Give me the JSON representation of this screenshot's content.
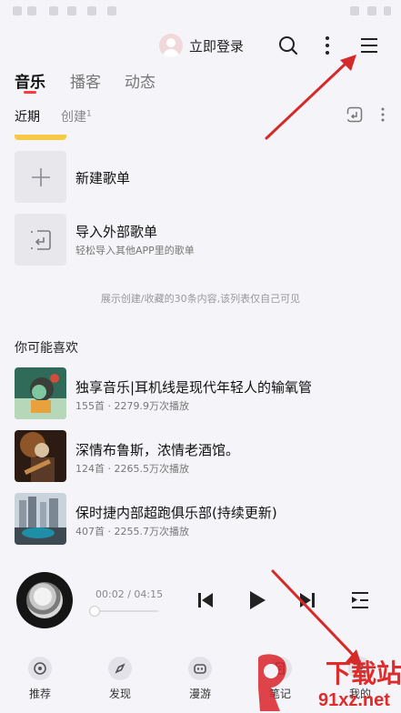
{
  "header": {
    "login_label": "立即登录"
  },
  "tabs": [
    {
      "label": "音乐",
      "active": true
    },
    {
      "label": "播客",
      "active": false
    },
    {
      "label": "动态",
      "active": false
    }
  ],
  "subtabs": {
    "recent": "近期",
    "created": "创建",
    "created_count": "1"
  },
  "actions": [
    {
      "title": "新建歌单",
      "subtitle": ""
    },
    {
      "title": "导入外部歌单",
      "subtitle": "轻松导入其他APP里的歌单"
    }
  ],
  "notice": "展示创建/收藏的30条内容,该列表仅自己可见",
  "recommend": {
    "title": "你可能喜欢",
    "items": [
      {
        "title": "独享音乐|耳机线是现代年轻人的输氧管",
        "meta": "155首 · 2279.9万次播放"
      },
      {
        "title": "深情布鲁斯，浓情老酒馆。",
        "meta": "124首 · 2265.5万次播放"
      },
      {
        "title": "保时捷内部超跑俱乐部(持续更新)",
        "meta": "407首 · 2255.7万次播放"
      }
    ]
  },
  "player": {
    "time": "00:02 / 04:15",
    "progress": 0.008
  },
  "nav": [
    {
      "label": "推荐"
    },
    {
      "label": "发现"
    },
    {
      "label": "漫游"
    },
    {
      "label": "笔记"
    },
    {
      "label": "我的"
    }
  ],
  "watermark": {
    "brand": "下载站",
    "url": "91xz.net"
  },
  "colors": {
    "accent": "#ff3a3a",
    "annotation_arrow": "#d42a2a",
    "yellow": "#f7c946"
  }
}
